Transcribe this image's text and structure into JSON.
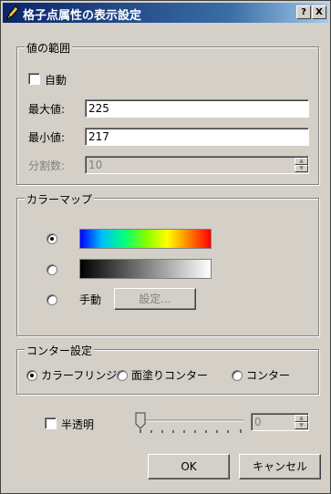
{
  "window": {
    "title": "格子点属性の表示設定",
    "help_label": "?",
    "close_label": "X"
  },
  "value_range": {
    "legend": "値の範囲",
    "auto_label": "自動",
    "max_label": "最大値:",
    "max_value": "225",
    "min_label": "最小値:",
    "min_value": "217",
    "div_label": "分割数:",
    "div_value": "10"
  },
  "colormap": {
    "legend": "カラーマップ",
    "manual_label": "手動",
    "settings_button": "設定..."
  },
  "contour": {
    "legend": "コンター設定",
    "option1": "カラーフリンジ",
    "option2": "面塗りコンター",
    "option3": "コンター"
  },
  "transparency": {
    "label": "半透明",
    "value": "0",
    "slider_level": 0
  },
  "buttons": {
    "ok": "OK",
    "cancel": "キャンセル"
  }
}
